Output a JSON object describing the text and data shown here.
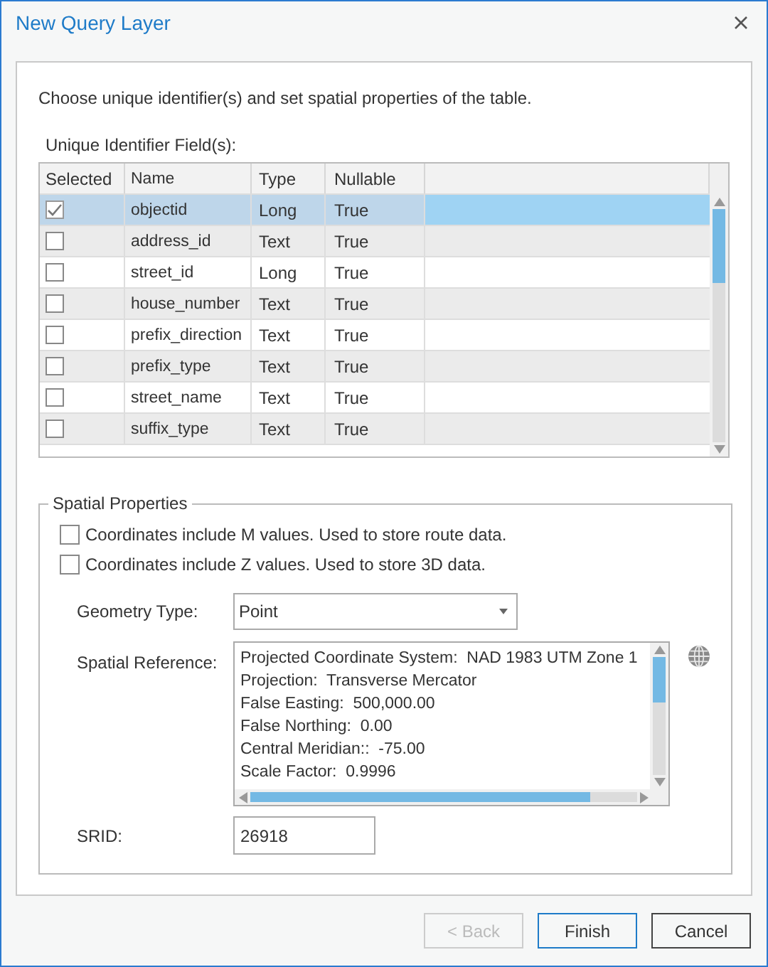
{
  "window": {
    "title": "New Query Layer"
  },
  "instructions": "Choose unique identifier(s) and set spatial properties of the table.",
  "fields_label": "Unique Identifier Field(s):",
  "table": {
    "columns": [
      "Selected",
      "Name",
      "Type",
      "Nullable"
    ],
    "rows": [
      {
        "selected": true,
        "checked": true,
        "name": "objectid",
        "type": "Long",
        "nullable": "True"
      },
      {
        "selected": false,
        "checked": false,
        "name": "address_id",
        "type": "Text",
        "nullable": "True"
      },
      {
        "selected": false,
        "checked": false,
        "name": "street_id",
        "type": "Long",
        "nullable": "True"
      },
      {
        "selected": false,
        "checked": false,
        "name": "house_number",
        "type": "Text",
        "nullable": "True"
      },
      {
        "selected": false,
        "checked": false,
        "name": "prefix_direction",
        "type": "Text",
        "nullable": "True"
      },
      {
        "selected": false,
        "checked": false,
        "name": "prefix_type",
        "type": "Text",
        "nullable": "True"
      },
      {
        "selected": false,
        "checked": false,
        "name": "street_name",
        "type": "Text",
        "nullable": "True"
      },
      {
        "selected": false,
        "checked": false,
        "name": "suffix_type",
        "type": "Text",
        "nullable": "True"
      }
    ]
  },
  "spatial_properties": {
    "title": "Spatial Properties",
    "options": [
      {
        "label": "Coordinates include M values. Used to store route data.",
        "checked": false
      },
      {
        "label": "Coordinates include Z values. Used to store 3D data.",
        "checked": false
      }
    ],
    "geometry_type": {
      "label": "Geometry Type:",
      "value": "Point"
    },
    "spatial_reference": {
      "label": "Spatial Reference:",
      "lines": [
        "Projected Coordinate System:  NAD 1983 UTM Zone 1",
        "Projection:  Transverse Mercator",
        "False Easting:  500,000.00",
        "False Northing:  0.00",
        "Central Meridian::  -75.00",
        "Scale Factor:  0.9996"
      ]
    },
    "srid": {
      "label": "SRID:",
      "value": "26918"
    }
  },
  "buttons": [
    {
      "label": "< Back",
      "disabled": true,
      "default": false
    },
    {
      "label": "Finish",
      "disabled": false,
      "default": true
    },
    {
      "label": "Cancel",
      "disabled": false,
      "default": false
    }
  ]
}
